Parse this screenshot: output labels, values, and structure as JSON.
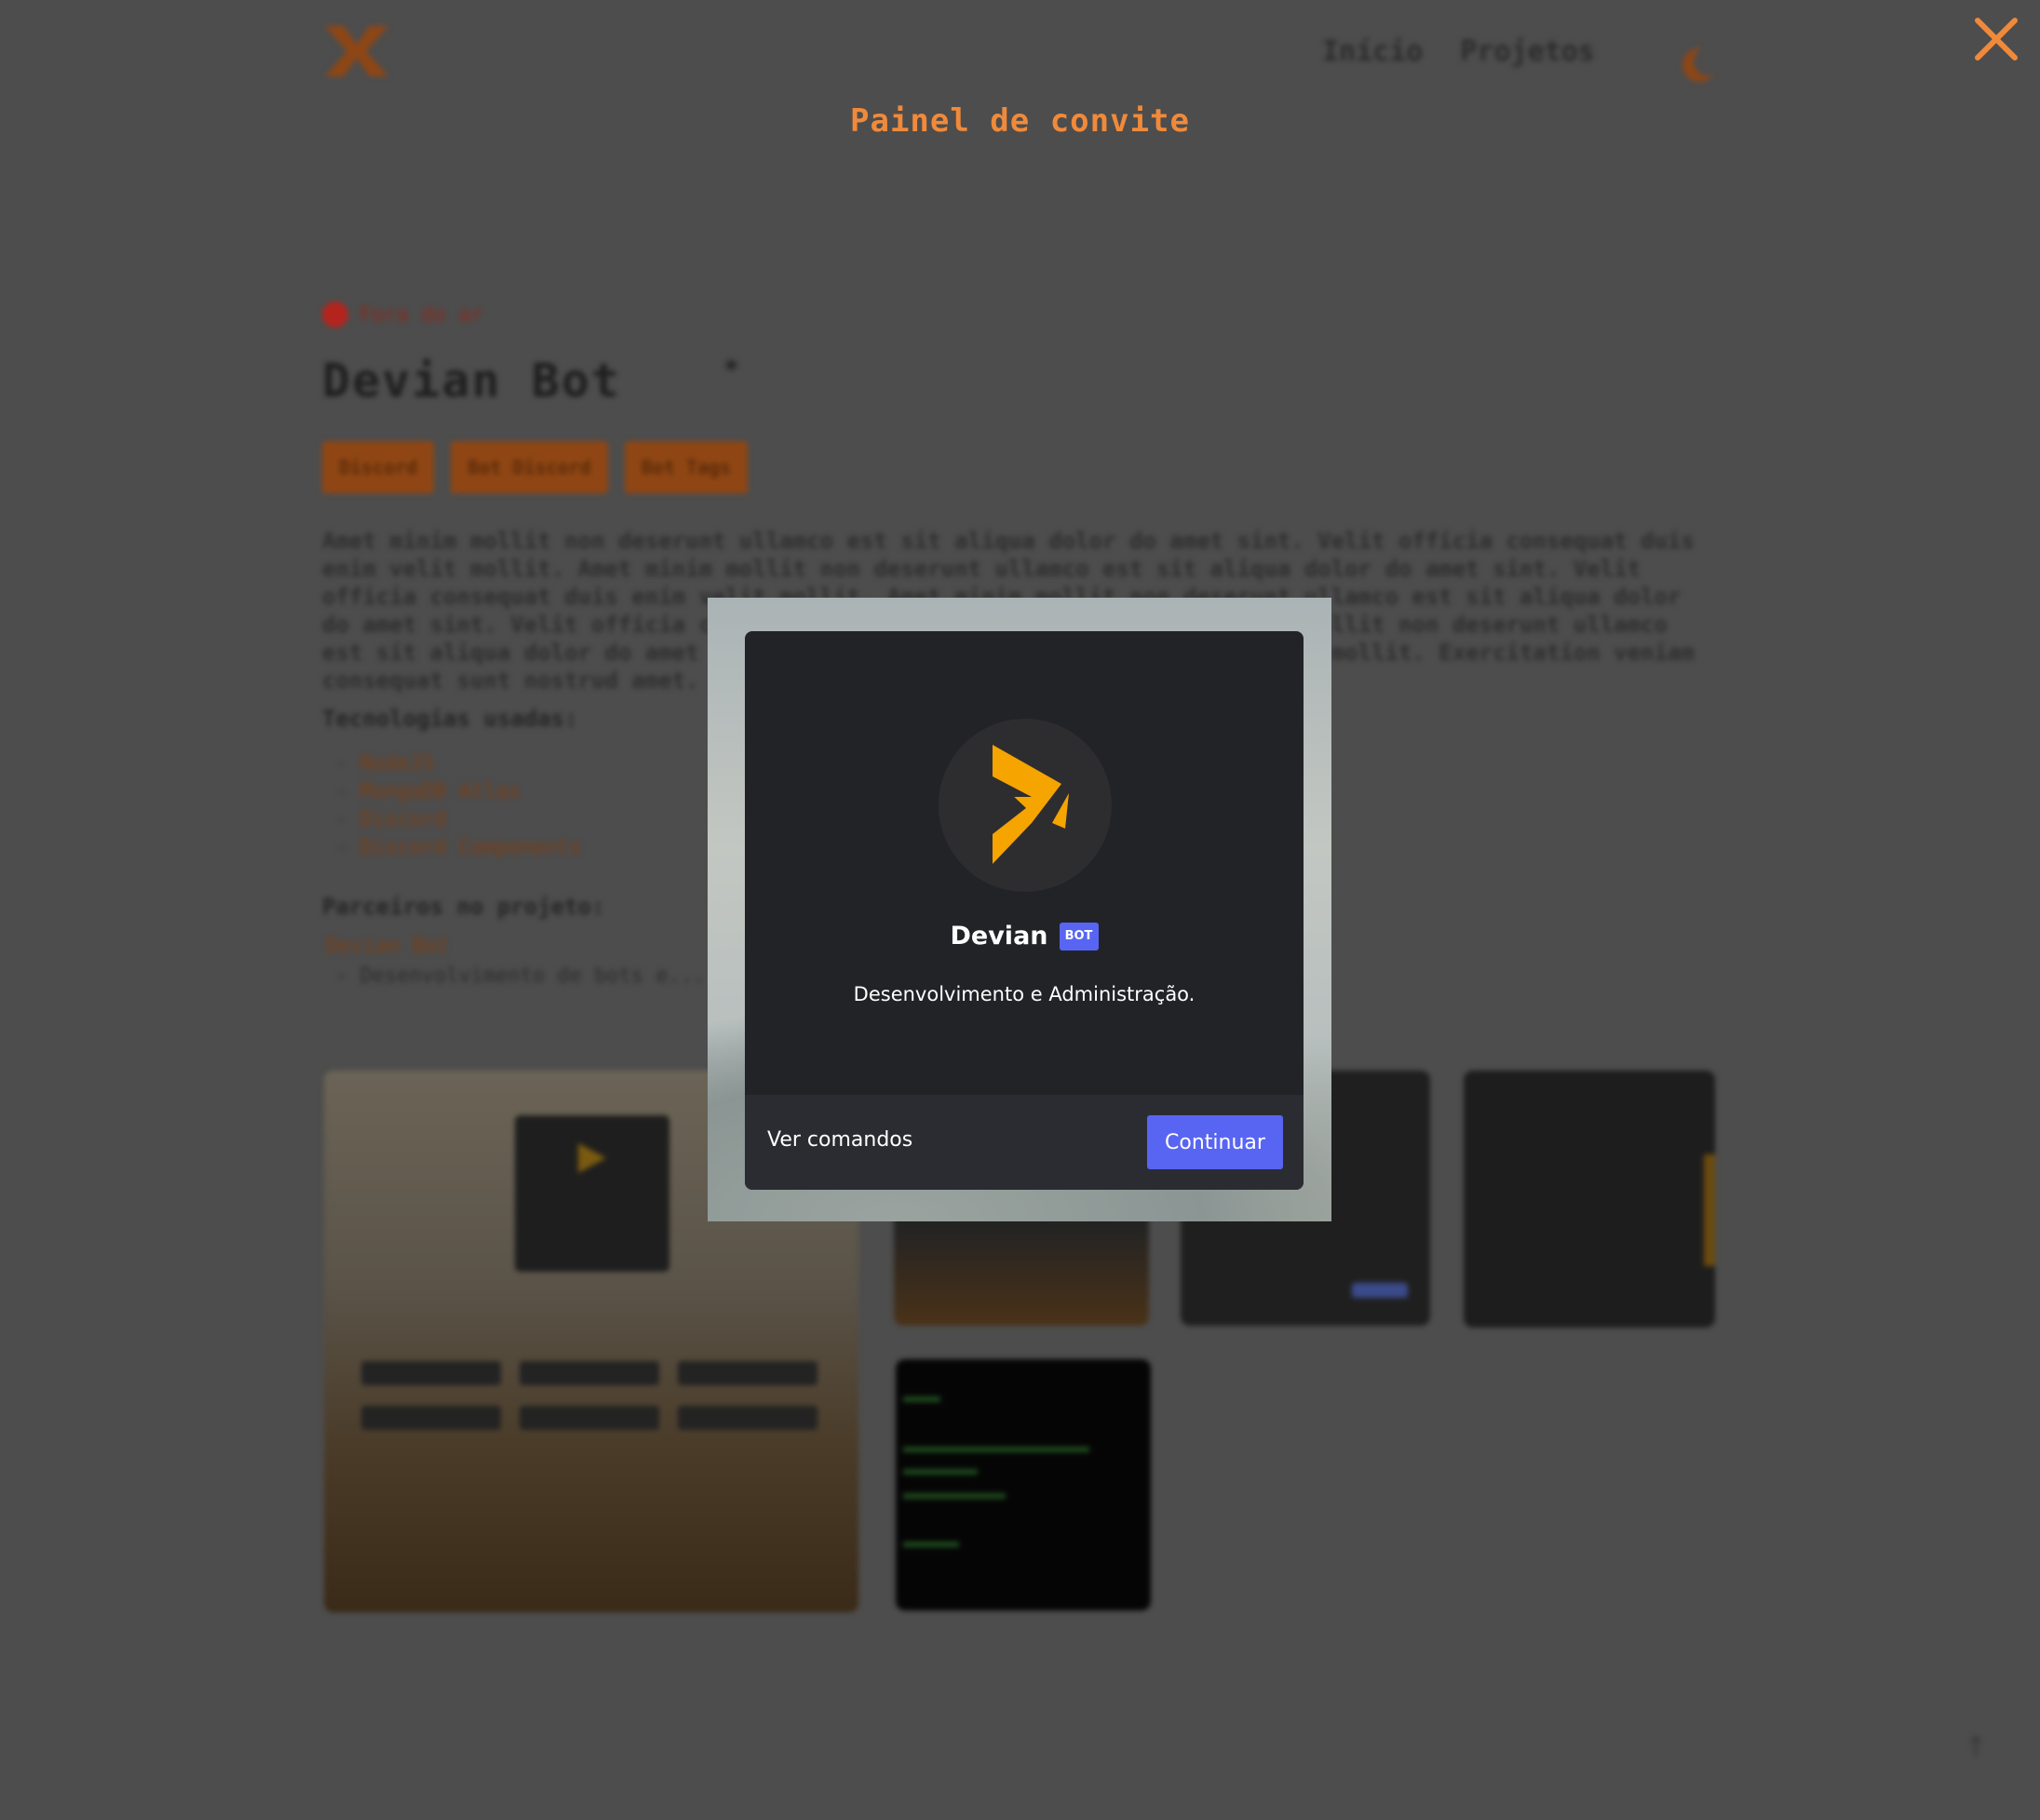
{
  "header": {
    "nav": [
      "Início",
      "Projetos"
    ]
  },
  "project": {
    "status": "Fora do ar",
    "title": "Devian Bot",
    "tags": [
      "Discord",
      "Bot Discord",
      "Bot Tags"
    ],
    "description": "Amet minim mollit non deserunt ullamco est sit aliqua dolor do amet sint. Velit officia consequat duis enim velit mollit. Amet minim mollit non deserunt ullamco est sit aliqua dolor do amet sint. Velit officia consequat duis enim velit mollit. Amet minim mollit non deserunt ullamco est sit aliqua dolor do amet sint. Velit officia consequat duis enim velit mollit. Amet minim mollit non deserunt ullamco est sit aliqua dolor do amet sint. Velit officia consequat duis enim velit mollit. Exercitation veniam consequat sunt nostrud amet.",
    "tech_heading": "Tecnologias usadas:",
    "technologies": [
      "NodeJS",
      "MongoDB Atlas",
      "Discord",
      "Discord Components"
    ],
    "partners_heading": "Parceiros no projeto:",
    "partner_name": "Devian Bot",
    "partner_desc": "- Desenvolvimento de bots e..."
  },
  "overlay": {
    "panel_title": "Painel de convite",
    "close_icon": "close-icon"
  },
  "invite": {
    "bot_name": "Devian",
    "bot_tag": "BOT",
    "description": "Desenvolvimento e Administração.",
    "secondary_action": "Ver comandos",
    "primary_action": "Continuar"
  },
  "colors": {
    "accent": "#f08a3a",
    "blurple": "#5865f2",
    "modal_bg": "#222327",
    "footer_bg": "#2b2c31",
    "logo_yellow": "#f5a400"
  }
}
